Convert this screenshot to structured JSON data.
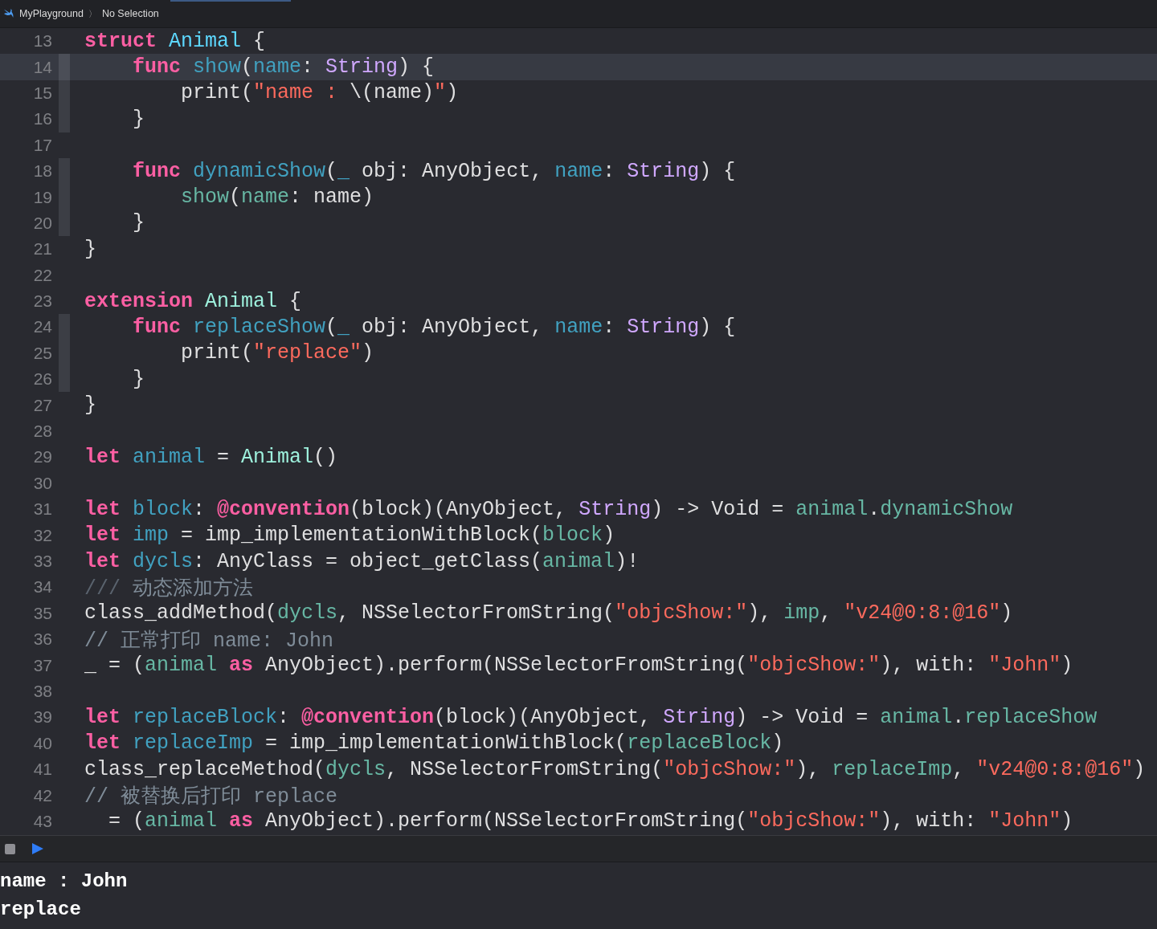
{
  "breadcrumb": {
    "project": "MyPlayground",
    "separator": "〉",
    "selection": "No Selection"
  },
  "editor": {
    "lines": [
      {
        "number": "13",
        "current": false,
        "fold": false,
        "tokens": [
          {
            "kind": "kw",
            "text": "struct"
          },
          {
            "kind": "type",
            "text": " Animal"
          },
          {
            "kind": "plain",
            "text": " {"
          }
        ]
      },
      {
        "number": "14",
        "current": true,
        "fold": true,
        "tokens": [
          {
            "kind": "kw",
            "text": "    func"
          },
          {
            "kind": "decl",
            "text": " show"
          },
          {
            "kind": "plain",
            "text": "("
          },
          {
            "kind": "decl",
            "text": "name"
          },
          {
            "kind": "plain",
            "text": ": "
          },
          {
            "kind": "sys",
            "text": "String"
          },
          {
            "kind": "plain",
            "text": ") {"
          }
        ]
      },
      {
        "number": "15",
        "current": false,
        "fold": true,
        "tokens": [
          {
            "kind": "plain",
            "text": "        print("
          },
          {
            "kind": "str",
            "text": "\"name : "
          },
          {
            "kind": "plain",
            "text": "\\(name)"
          },
          {
            "kind": "str",
            "text": "\""
          },
          {
            "kind": "plain",
            "text": ")"
          }
        ]
      },
      {
        "number": "16",
        "current": false,
        "fold": true,
        "tokens": [
          {
            "kind": "plain",
            "text": "    }"
          }
        ]
      },
      {
        "number": "17",
        "current": false,
        "fold": false
      },
      {
        "number": "18",
        "current": false,
        "fold": true,
        "tokens": [
          {
            "kind": "kw",
            "text": "    func"
          },
          {
            "kind": "decl",
            "text": " dynamicShow"
          },
          {
            "kind": "plain",
            "text": "("
          },
          {
            "kind": "decl",
            "text": "_"
          },
          {
            "kind": "plain",
            "text": " obj: AnyObject, "
          },
          {
            "kind": "decl",
            "text": "name"
          },
          {
            "kind": "plain",
            "text": ": "
          },
          {
            "kind": "sys",
            "text": "String"
          },
          {
            "kind": "plain",
            "text": ") {"
          }
        ]
      },
      {
        "number": "19",
        "current": false,
        "fold": true,
        "tokens": [
          {
            "kind": "proj",
            "text": "        show"
          },
          {
            "kind": "plain",
            "text": "("
          },
          {
            "kind": "proj",
            "text": "name"
          },
          {
            "kind": "plain",
            "text": ": name)"
          }
        ]
      },
      {
        "number": "20",
        "current": false,
        "fold": true,
        "tokens": [
          {
            "kind": "plain",
            "text": "    }"
          }
        ]
      },
      {
        "number": "21",
        "current": false,
        "fold": false,
        "tokens": [
          {
            "kind": "plain",
            "text": "}"
          }
        ]
      },
      {
        "number": "22",
        "current": false,
        "fold": false
      },
      {
        "number": "23",
        "current": false,
        "fold": false,
        "tokens": [
          {
            "kind": "kw",
            "text": "extension"
          },
          {
            "kind": "projtype",
            "text": " Animal"
          },
          {
            "kind": "plain",
            "text": " {"
          }
        ]
      },
      {
        "number": "24",
        "current": false,
        "fold": true,
        "tokens": [
          {
            "kind": "kw",
            "text": "    func"
          },
          {
            "kind": "decl",
            "text": " replaceShow"
          },
          {
            "kind": "plain",
            "text": "("
          },
          {
            "kind": "decl",
            "text": "_"
          },
          {
            "kind": "plain",
            "text": " obj: AnyObject, "
          },
          {
            "kind": "decl",
            "text": "name"
          },
          {
            "kind": "plain",
            "text": ": "
          },
          {
            "kind": "sys",
            "text": "String"
          },
          {
            "kind": "plain",
            "text": ") {"
          }
        ]
      },
      {
        "number": "25",
        "current": false,
        "fold": true,
        "tokens": [
          {
            "kind": "plain",
            "text": "        print("
          },
          {
            "kind": "str",
            "text": "\"replace\""
          },
          {
            "kind": "plain",
            "text": ")"
          }
        ]
      },
      {
        "number": "26",
        "current": false,
        "fold": true,
        "tokens": [
          {
            "kind": "plain",
            "text": "    }"
          }
        ]
      },
      {
        "number": "27",
        "current": false,
        "fold": false,
        "tokens": [
          {
            "kind": "plain",
            "text": "}"
          }
        ]
      },
      {
        "number": "28",
        "current": false,
        "fold": false
      },
      {
        "number": "29",
        "current": false,
        "fold": false,
        "tokens": [
          {
            "kind": "kw",
            "text": "let"
          },
          {
            "kind": "decl",
            "text": " animal"
          },
          {
            "kind": "plain",
            "text": " = "
          },
          {
            "kind": "projtype",
            "text": "Animal"
          },
          {
            "kind": "plain",
            "text": "()"
          }
        ]
      },
      {
        "number": "30",
        "current": false,
        "fold": false
      },
      {
        "number": "31",
        "current": false,
        "fold": false,
        "tokens": [
          {
            "kind": "kw",
            "text": "let"
          },
          {
            "kind": "decl",
            "text": " block"
          },
          {
            "kind": "plain",
            "text": ": "
          },
          {
            "kind": "kw",
            "text": "@convention"
          },
          {
            "kind": "plain",
            "text": "(block)(AnyObject, "
          },
          {
            "kind": "sys",
            "text": "String"
          },
          {
            "kind": "plain",
            "text": ") -> Void = "
          },
          {
            "kind": "proj",
            "text": "animal"
          },
          {
            "kind": "plain",
            "text": "."
          },
          {
            "kind": "proj",
            "text": "dynamicShow"
          }
        ]
      },
      {
        "number": "32",
        "current": false,
        "fold": false,
        "tokens": [
          {
            "kind": "kw",
            "text": "let"
          },
          {
            "kind": "decl",
            "text": " imp"
          },
          {
            "kind": "plain",
            "text": " = imp_implementationWithBlock("
          },
          {
            "kind": "proj",
            "text": "block"
          },
          {
            "kind": "plain",
            "text": ")"
          }
        ]
      },
      {
        "number": "33",
        "current": false,
        "fold": false,
        "tokens": [
          {
            "kind": "kw",
            "text": "let"
          },
          {
            "kind": "decl",
            "text": " dycls"
          },
          {
            "kind": "plain",
            "text": ": AnyClass = object_getClass("
          },
          {
            "kind": "proj",
            "text": "animal"
          },
          {
            "kind": "plain",
            "text": ")!"
          }
        ]
      },
      {
        "number": "34",
        "current": false,
        "fold": false,
        "tokens": [
          {
            "kind": "docmark",
            "text": "///"
          },
          {
            "kind": "cmt",
            "text": " 动态添加方法"
          }
        ]
      },
      {
        "number": "35",
        "current": false,
        "fold": false,
        "tokens": [
          {
            "kind": "plain",
            "text": "class_addMethod("
          },
          {
            "kind": "proj",
            "text": "dycls"
          },
          {
            "kind": "plain",
            "text": ", NSSelectorFromString("
          },
          {
            "kind": "str",
            "text": "\"objcShow:\""
          },
          {
            "kind": "plain",
            "text": "), "
          },
          {
            "kind": "proj",
            "text": "imp"
          },
          {
            "kind": "plain",
            "text": ", "
          },
          {
            "kind": "str",
            "text": "\"v24@0:8:@16\""
          },
          {
            "kind": "plain",
            "text": ")"
          }
        ]
      },
      {
        "number": "36",
        "current": false,
        "fold": false,
        "tokens": [
          {
            "kind": "cmt",
            "text": "// 正常打印 name: John"
          }
        ]
      },
      {
        "number": "37",
        "current": false,
        "fold": false,
        "tokens": [
          {
            "kind": "plain",
            "text": "_ = ("
          },
          {
            "kind": "proj",
            "text": "animal"
          },
          {
            "kind": "kw",
            "text": " as"
          },
          {
            "kind": "plain",
            "text": " AnyObject).perform(NSSelectorFromString("
          },
          {
            "kind": "str",
            "text": "\"objcShow:\""
          },
          {
            "kind": "plain",
            "text": "), with: "
          },
          {
            "kind": "str",
            "text": "\"John\""
          },
          {
            "kind": "plain",
            "text": ")"
          }
        ]
      },
      {
        "number": "38",
        "current": false,
        "fold": false
      },
      {
        "number": "39",
        "current": false,
        "fold": false,
        "tokens": [
          {
            "kind": "kw",
            "text": "let"
          },
          {
            "kind": "decl",
            "text": " replaceBlock"
          },
          {
            "kind": "plain",
            "text": ": "
          },
          {
            "kind": "kw",
            "text": "@convention"
          },
          {
            "kind": "plain",
            "text": "(block)(AnyObject, "
          },
          {
            "kind": "sys",
            "text": "String"
          },
          {
            "kind": "plain",
            "text": ") -> Void = "
          },
          {
            "kind": "proj",
            "text": "animal"
          },
          {
            "kind": "plain",
            "text": "."
          },
          {
            "kind": "proj",
            "text": "replaceShow"
          }
        ]
      },
      {
        "number": "40",
        "current": false,
        "fold": false,
        "tokens": [
          {
            "kind": "kw",
            "text": "let"
          },
          {
            "kind": "decl",
            "text": " replaceImp"
          },
          {
            "kind": "plain",
            "text": " = imp_implementationWithBlock("
          },
          {
            "kind": "proj",
            "text": "replaceBlock"
          },
          {
            "kind": "plain",
            "text": ")"
          }
        ]
      },
      {
        "number": "41",
        "current": false,
        "fold": false,
        "tokens": [
          {
            "kind": "plain",
            "text": "class_replaceMethod("
          },
          {
            "kind": "proj",
            "text": "dycls"
          },
          {
            "kind": "plain",
            "text": ", NSSelectorFromString("
          },
          {
            "kind": "str",
            "text": "\"objcShow:\""
          },
          {
            "kind": "plain",
            "text": "), "
          },
          {
            "kind": "proj",
            "text": "replaceImp"
          },
          {
            "kind": "plain",
            "text": ", "
          },
          {
            "kind": "str",
            "text": "\"v24@0:8:@16\""
          },
          {
            "kind": "plain",
            "text": ")"
          }
        ]
      },
      {
        "number": "42",
        "current": false,
        "fold": false,
        "tokens": [
          {
            "kind": "cmt",
            "text": "// 被替换后打印 replace"
          }
        ]
      },
      {
        "number": "43",
        "current": false,
        "fold": false,
        "tokens": [
          {
            "kind": "plain",
            "text": "  = ("
          },
          {
            "kind": "proj",
            "text": "animal"
          },
          {
            "kind": "kw",
            "text": " as"
          },
          {
            "kind": "plain",
            "text": " AnyObject).perform(NSSelectorFromString("
          },
          {
            "kind": "str",
            "text": "\"objcShow:\""
          },
          {
            "kind": "plain",
            "text": "), with: "
          },
          {
            "kind": "str",
            "text": "\"John\""
          },
          {
            "kind": "plain",
            "text": ")"
          }
        ]
      }
    ]
  },
  "console": {
    "output": [
      "name : John",
      "replace"
    ]
  }
}
